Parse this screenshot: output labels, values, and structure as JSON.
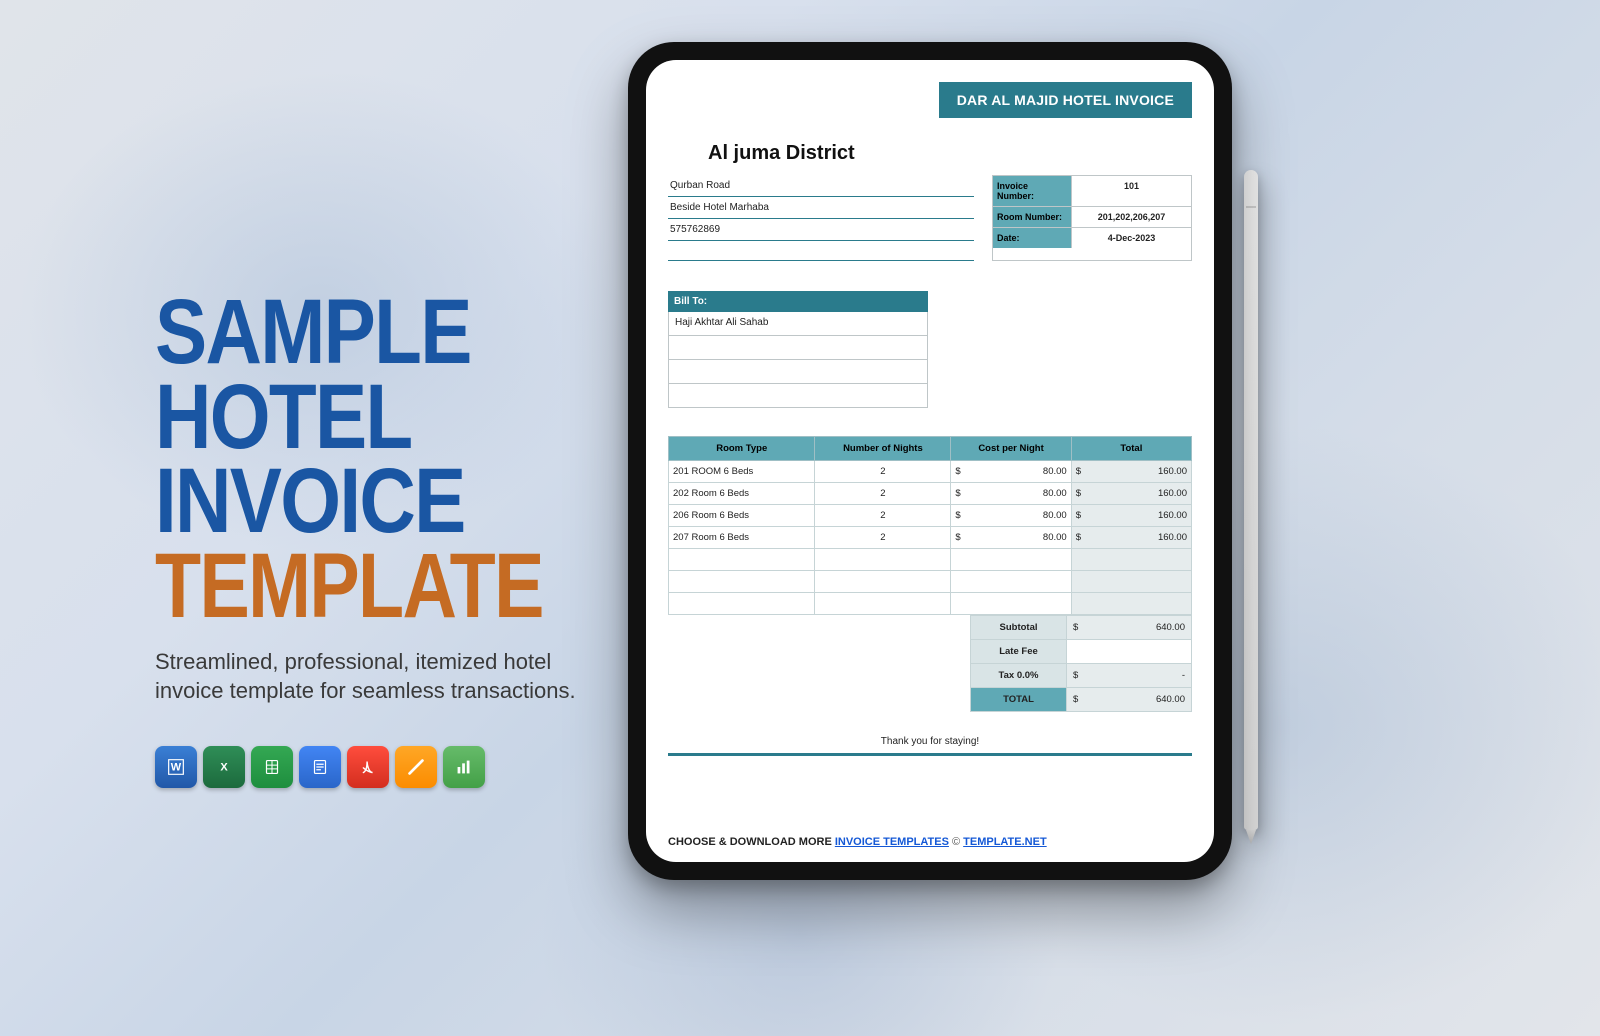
{
  "hero": {
    "l1": "SAMPLE",
    "l2": "HOTEL",
    "l3": "INVOICE",
    "l4": "TEMPLATE"
  },
  "tagline": "Streamlined, professional, itemized hotel invoice template for seamless transactions.",
  "icons": [
    "word",
    "excel",
    "sheets",
    "docs",
    "pdf",
    "pages",
    "numbers"
  ],
  "invoice": {
    "banner": "DAR AL MAJID HOTEL INVOICE",
    "district": "Al juma District",
    "address": {
      "line1": "Qurban Road",
      "line2": "Beside Hotel Marhaba",
      "line3": "575762869"
    },
    "meta": {
      "invoice_number_label": "Invoice Number:",
      "invoice_number": "101",
      "room_number_label": "Room Number:",
      "room_number": "201,202,206,207",
      "date_label": "Date:",
      "date": "4-Dec-2023"
    },
    "billto": {
      "header": "Bill To:",
      "name": "Haji Akhtar Ali Sahab"
    },
    "columns": {
      "room_type": "Room Type",
      "nights": "Number of Nights",
      "cost": "Cost per Night",
      "total": "Total"
    },
    "items": [
      {
        "room": "201 ROOM 6 Beds",
        "nights": "2",
        "cost": "80.00",
        "total": "160.00"
      },
      {
        "room": "202 Room 6 Beds",
        "nights": "2",
        "cost": "80.00",
        "total": "160.00"
      },
      {
        "room": "206 Room 6 Beds",
        "nights": "2",
        "cost": "80.00",
        "total": "160.00"
      },
      {
        "room": "207 Room 6 Beds",
        "nights": "2",
        "cost": "80.00",
        "total": "160.00"
      }
    ],
    "totals": {
      "subtotal_label": "Subtotal",
      "subtotal": "640.00",
      "latefee_label": "Late Fee",
      "latefee": "",
      "tax_label": "Tax  0.0%",
      "tax": "-",
      "total_label": "TOTAL",
      "total": "640.00"
    },
    "currency": "$",
    "thanks": "Thank you for staying!",
    "footer": {
      "lead": "CHOOSE & DOWNLOAD MORE ",
      "link1": "INVOICE TEMPLATES",
      "copy": " © ",
      "link2": "TEMPLATE.NET"
    }
  }
}
